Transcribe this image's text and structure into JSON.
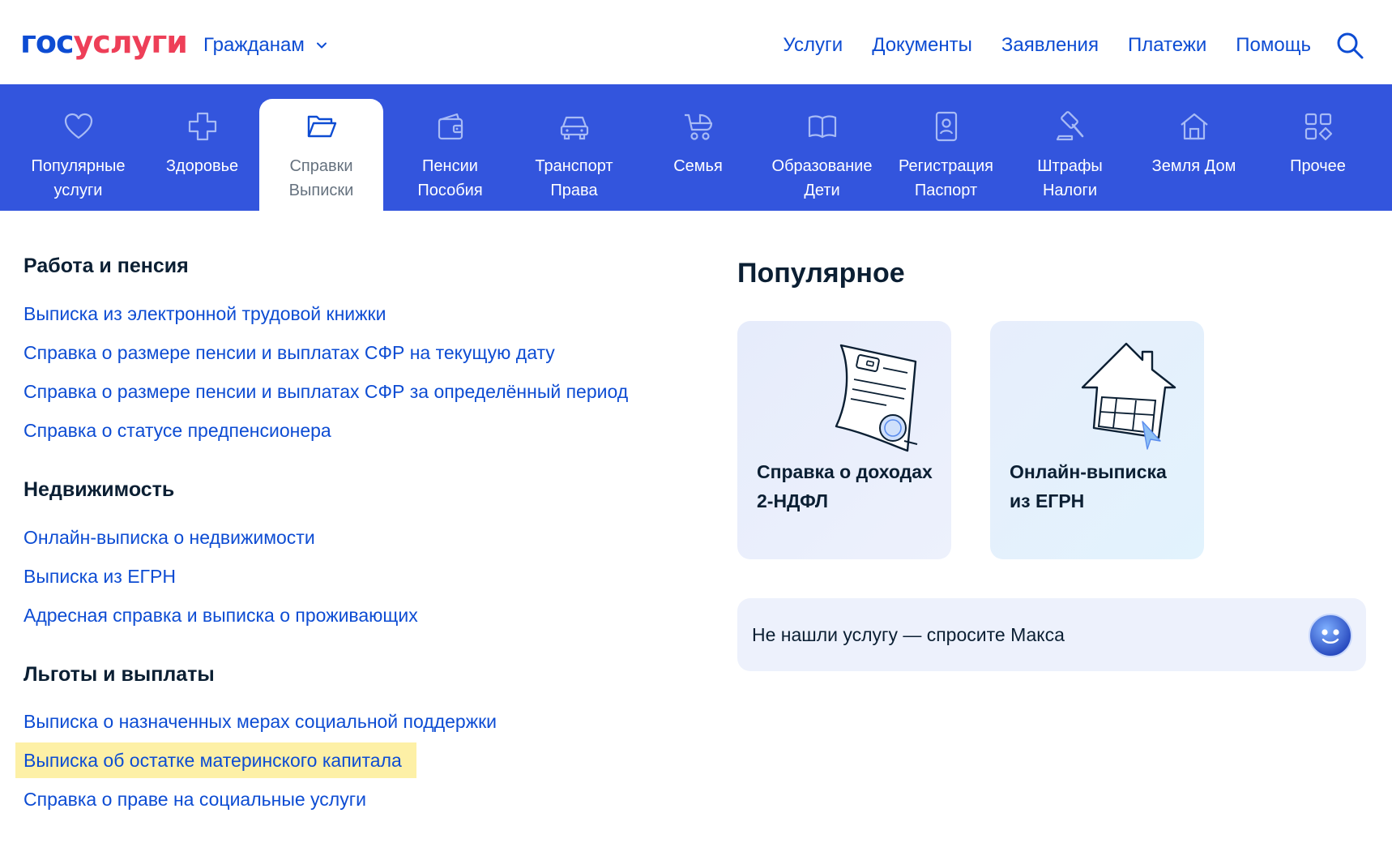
{
  "header": {
    "logo_part1": "гос",
    "logo_part2": "услуги",
    "audience": "Гражданам",
    "nav": [
      "Услуги",
      "Документы",
      "Заявления",
      "Платежи",
      "Помощь"
    ]
  },
  "categories": [
    {
      "line1": "Популярные",
      "line2": "услуги",
      "icon": "heart-icon"
    },
    {
      "line1": "Здоровье",
      "line2": "",
      "icon": "medical-cross-icon"
    },
    {
      "line1": "Справки",
      "line2": "Выписки",
      "icon": "folder-icon",
      "active": true
    },
    {
      "line1": "Пенсии",
      "line2": "Пособия",
      "icon": "wallet-icon"
    },
    {
      "line1": "Транспорт",
      "line2": "Права",
      "icon": "car-icon"
    },
    {
      "line1": "Семья",
      "line2": "",
      "icon": "stroller-icon"
    },
    {
      "line1": "Образование",
      "line2": "Дети",
      "icon": "book-icon"
    },
    {
      "line1": "Регистрация",
      "line2": "Паспорт",
      "icon": "id-card-icon"
    },
    {
      "line1": "Штрафы",
      "line2": "Налоги",
      "icon": "gavel-icon"
    },
    {
      "line1": "Земля Дом",
      "line2": "",
      "icon": "house-icon"
    },
    {
      "line1": "Прочее",
      "line2": "",
      "icon": "grid-icon"
    }
  ],
  "sections": [
    {
      "title": "Работа и пенсия",
      "links": [
        "Выписка из электронной трудовой книжки",
        "Справка о размере пенсии и выплатах СФР на текущую дату",
        "Справка о размере пенсии и выплатах СФР за определённый период",
        "Справка о статусе предпенсионера"
      ]
    },
    {
      "title": "Недвижимость",
      "links": [
        "Онлайн-выписка о недвижимости",
        "Выписка из ЕГРН",
        "Адресная справка и выписка о проживающих"
      ]
    },
    {
      "title": "Льготы и выплаты",
      "links": [
        "Выписка о назначенных мерах социальной поддержки",
        "Выписка об остатке материнского капитала",
        "Справка о праве на социальные услуги"
      ]
    }
  ],
  "popular": {
    "title": "Популярное",
    "cards": [
      {
        "line1": "Справка о доходах",
        "line2": "2-НДФЛ",
        "illustration": "document-icon"
      },
      {
        "line1": "Онлайн-выписка",
        "line2": "из ЕГРН",
        "illustration": "house-plan-icon"
      }
    ],
    "ask_text": "Не нашли услугу — спросите Макса",
    "ask_icon": "robot-assistant-icon"
  },
  "colors": {
    "brand_blue": "#0d4cd3",
    "brand_red": "#ee3f58",
    "catbar_bg": "#3355dd",
    "highlight": "#fdf0a6"
  }
}
